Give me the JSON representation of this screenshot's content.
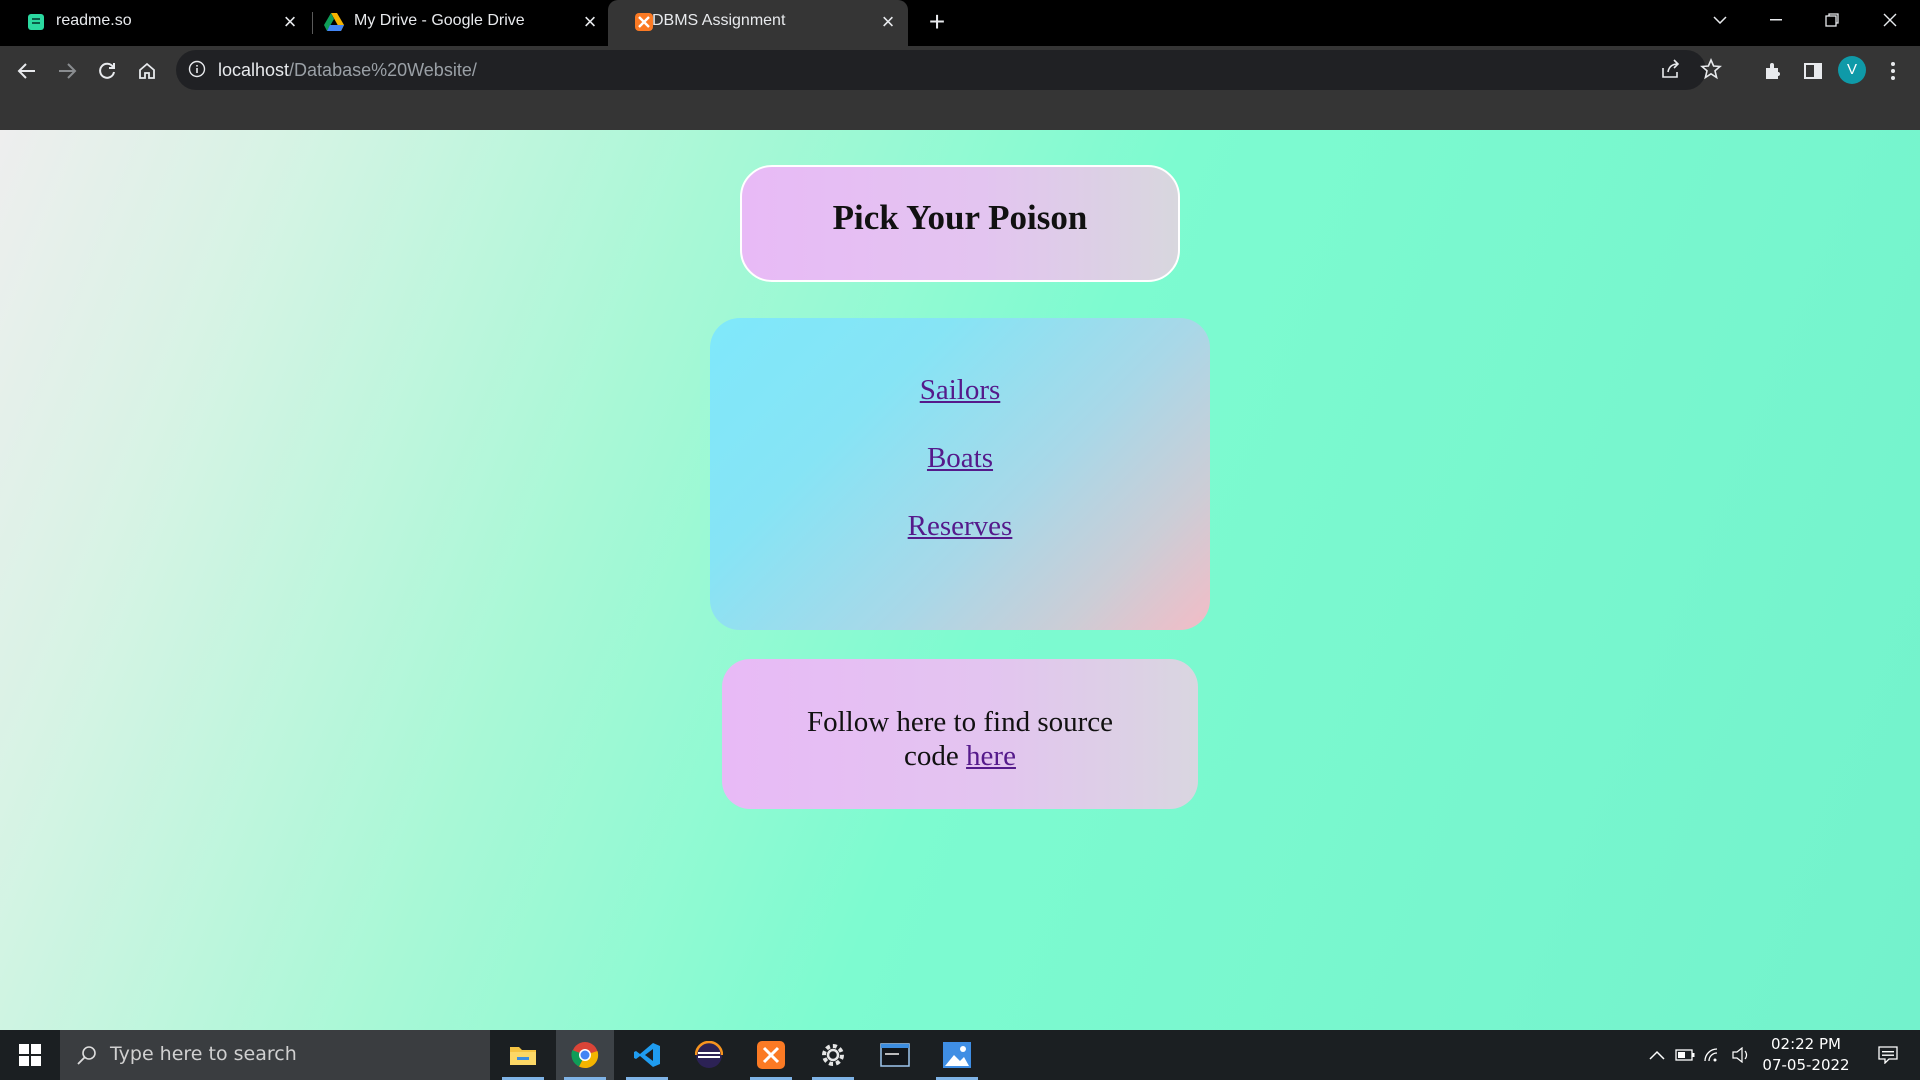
{
  "browser": {
    "tabs": [
      {
        "title": "readme.so",
        "favicon": "readme-icon",
        "active": false
      },
      {
        "title": "My Drive - Google Drive",
        "favicon": "google-drive-icon",
        "active": false
      },
      {
        "title": "DBMS Assignment",
        "favicon": "xampp-icon",
        "active": true
      }
    ],
    "address": {
      "host": "localhost",
      "path": "/Database%20Website/"
    },
    "profile_initial": "V",
    "accent": "#0f9aa8"
  },
  "page": {
    "title": "Pick Your Poison",
    "links": [
      {
        "label": "Sailors"
      },
      {
        "label": "Boats"
      },
      {
        "label": "Reserves"
      }
    ],
    "follow_text": "Follow here to find source code",
    "follow_link": "here",
    "link_color": "#551a8b"
  },
  "taskbar": {
    "search_placeholder": "Type here to search",
    "apps": [
      "file-explorer",
      "chrome",
      "vscode",
      "eclipse",
      "xampp",
      "settings",
      "mysql",
      "photos"
    ],
    "time": "02:22 PM",
    "date": "07-05-2022"
  }
}
